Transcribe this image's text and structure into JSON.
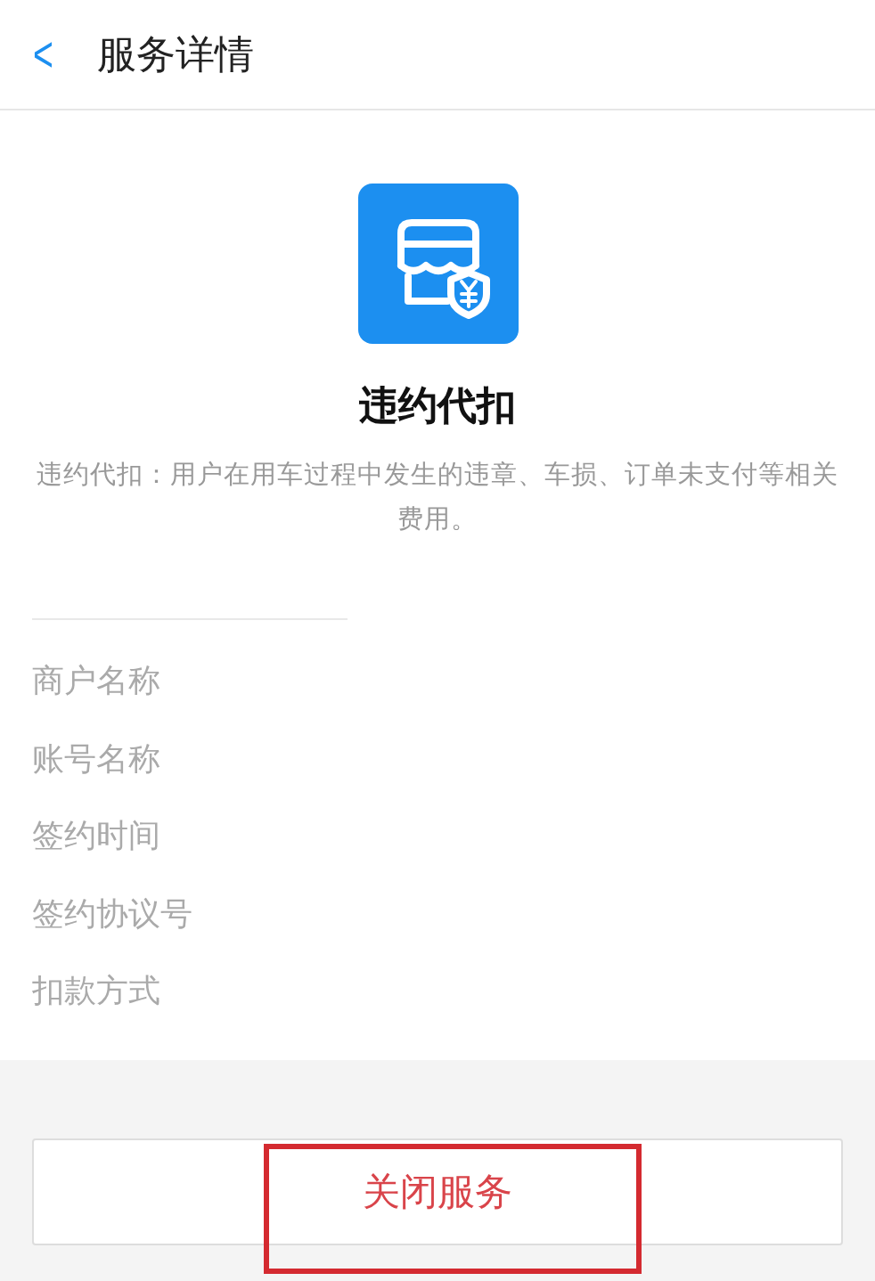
{
  "header": {
    "back_icon": "<",
    "title": "服务详情"
  },
  "service": {
    "name": "违约代扣",
    "description": "违约代扣：用户在用车过程中发生的违章、车损、订单未支付等相关费用。"
  },
  "fields": [
    {
      "label": "商户名称"
    },
    {
      "label": "账号名称"
    },
    {
      "label": "签约时间"
    },
    {
      "label": "签约协议号"
    },
    {
      "label": "扣款方式"
    }
  ],
  "close_button": {
    "label": "关闭服务",
    "highlighted": true
  }
}
